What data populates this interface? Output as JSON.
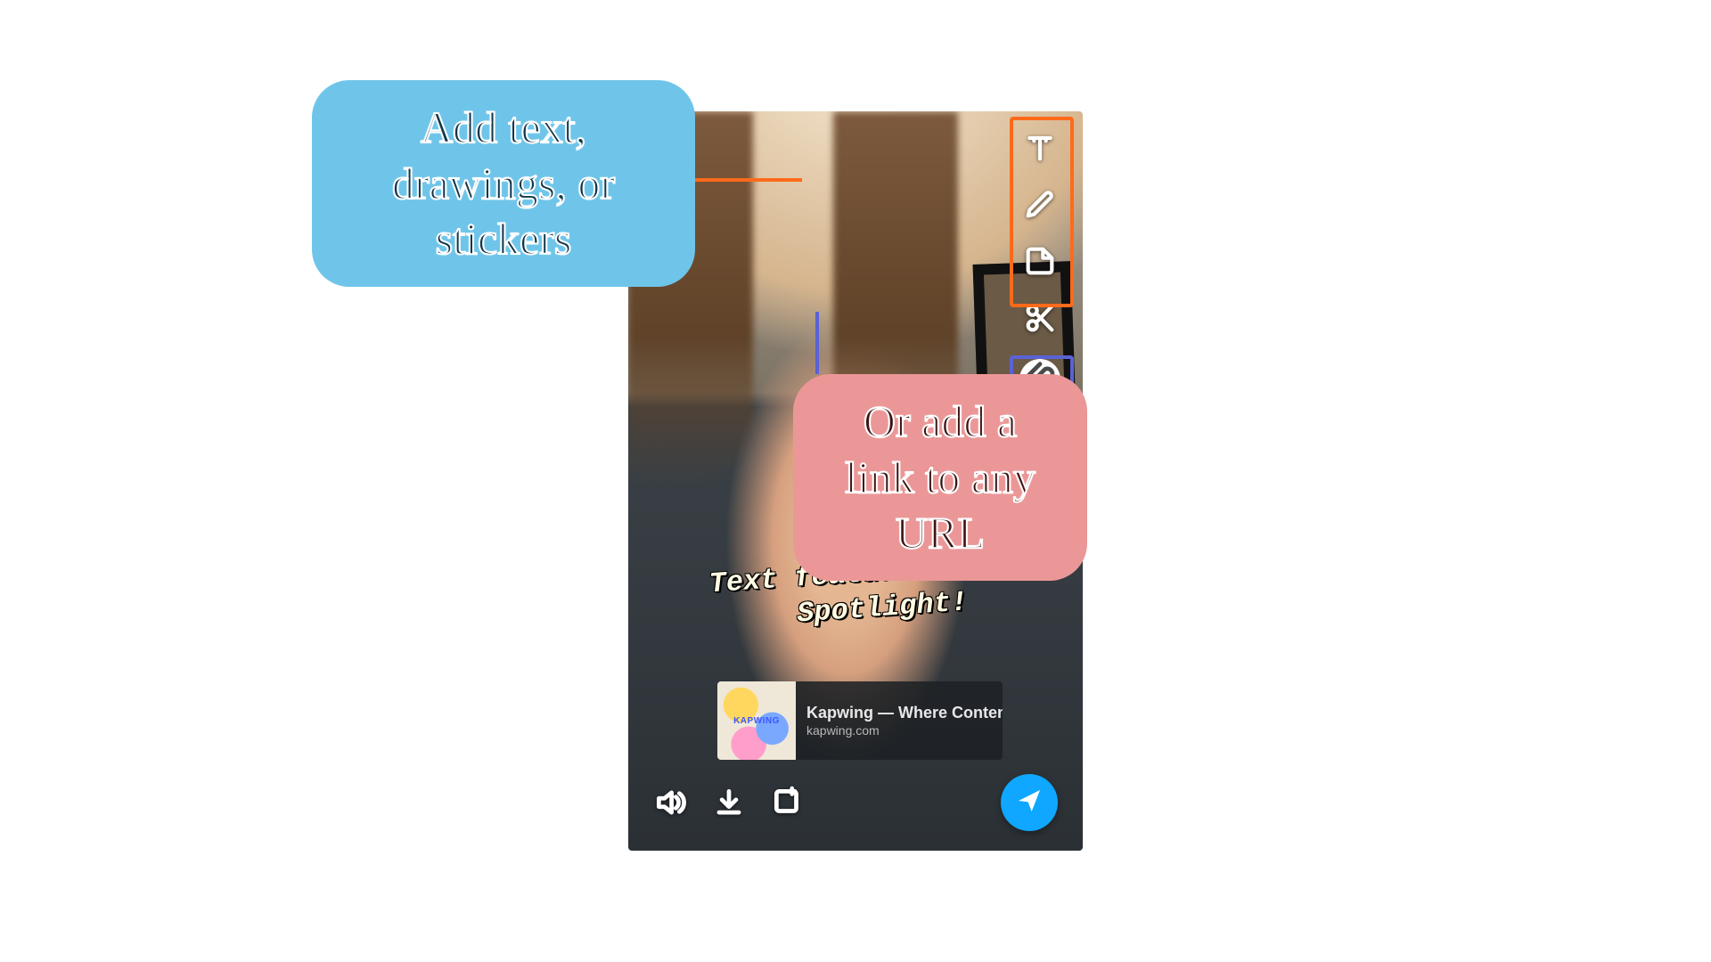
{
  "caption_text": "Text features for\n   Spotlight!",
  "link_card": {
    "thumb_label": "KAPWING",
    "title": "Kapwing — Where Content Creation Happ…",
    "url": "kapwing.com"
  },
  "annotations": {
    "tools_callout": "Add text, drawings, or stickers",
    "link_callout": "Or add a link to any URL"
  },
  "colors": {
    "highlight_tools": "#ff6a1a",
    "highlight_attach": "#5a62d6",
    "callout_blue": "#6fc5e9",
    "callout_pink": "#eb9797",
    "send_button": "#0fa7ff"
  },
  "tool_icons": [
    "text-icon",
    "draw-icon",
    "sticker-icon",
    "scissors-icon",
    "attach-icon",
    "music-icon"
  ],
  "bottom_icons": [
    "sound-icon",
    "download-icon",
    "add-to-story-icon"
  ]
}
